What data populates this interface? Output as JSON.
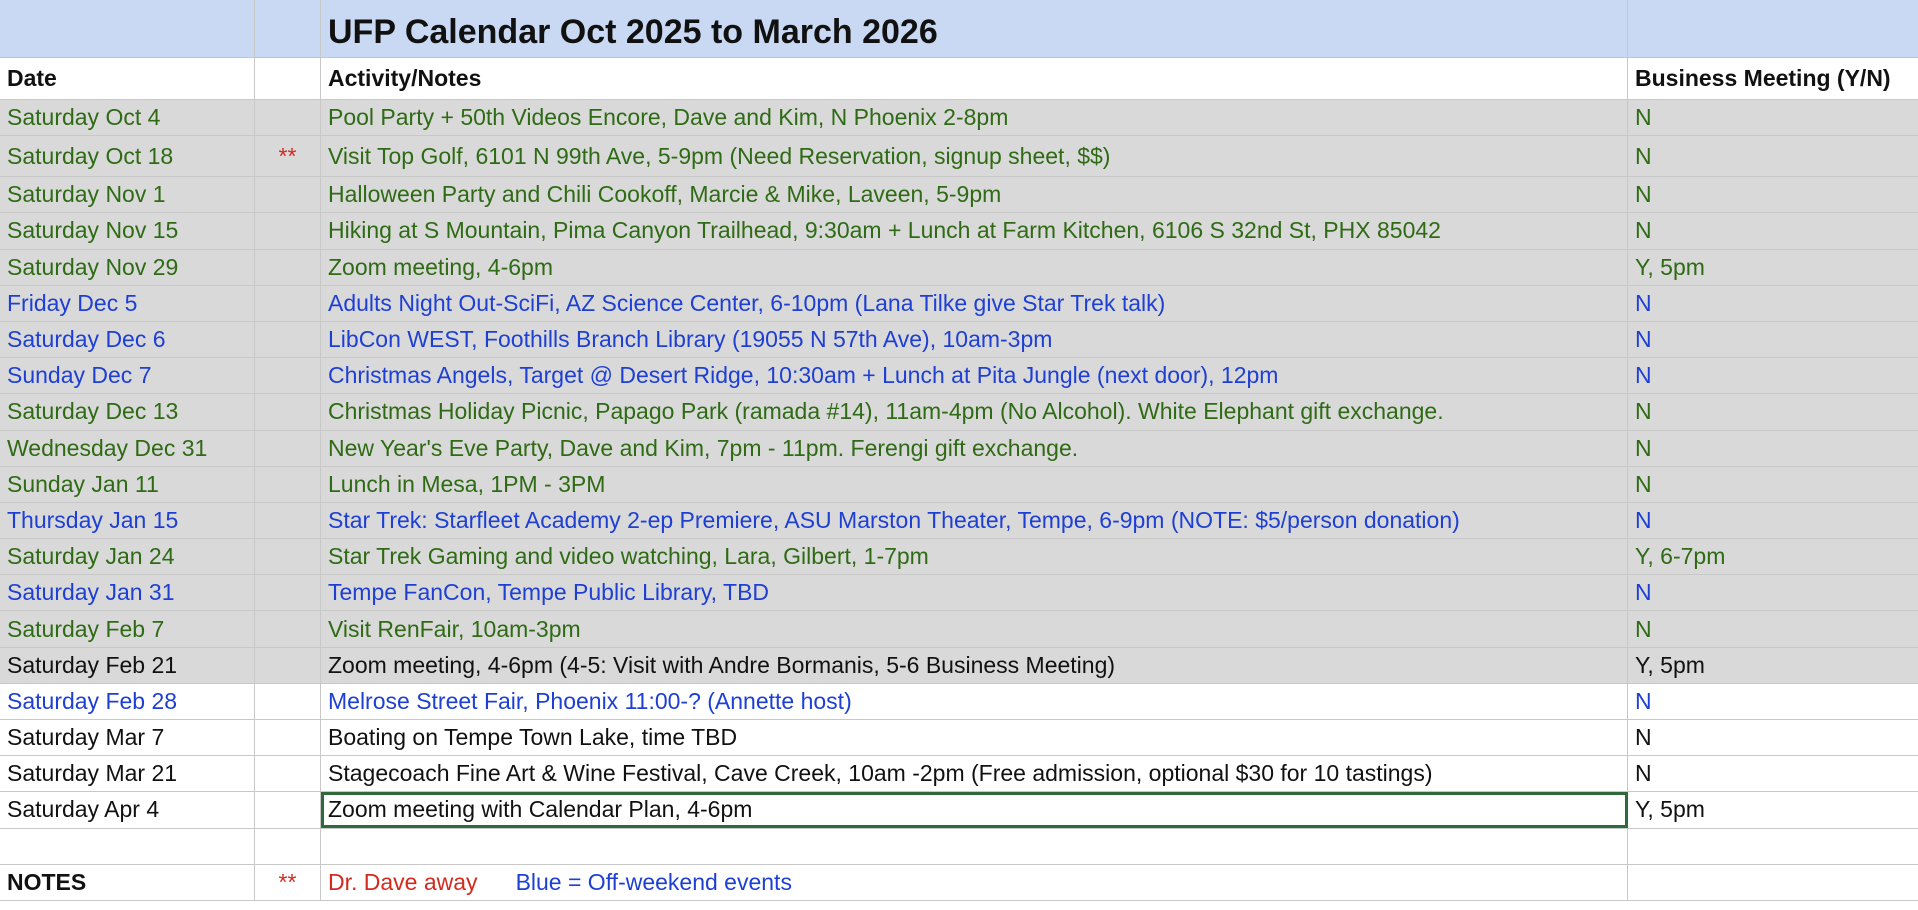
{
  "title": "UFP Calendar Oct 2025 to March 2026",
  "headers": {
    "date": "Date",
    "flag": "",
    "activity": "Activity/Notes",
    "business": "Business Meeting (Y/N)"
  },
  "colors": {
    "green": "#2e6b14",
    "blue": "#1e3fd4",
    "black": "#111111",
    "red": "#d42a1e",
    "title_bg": "#c9d9f3",
    "row_grey": "#d9d9d9"
  },
  "rows": [
    {
      "date": "Saturday Oct 4",
      "flag": "",
      "activity": "Pool Party + 50th Videos Encore, Dave and Kim, N Phoenix 2-8pm",
      "business": "N"
    },
    {
      "date": "Saturday Oct 18",
      "flag": "**",
      "activity": "Visit Top Golf, 6101 N 99th Ave, 5-9pm (Need Reservation, signup sheet, $$)",
      "business": "N"
    },
    {
      "date": "Saturday Nov 1",
      "flag": "",
      "activity": "Halloween Party and Chili Cookoff, Marcie & Mike, Laveen, 5-9pm",
      "business": "N"
    },
    {
      "date": "Saturday Nov 15",
      "flag": "",
      "activity": "Hiking at S Mountain, Pima Canyon Trailhead, 9:30am + Lunch at Farm Kitchen, 6106 S 32nd St, PHX 85042",
      "business": "N"
    },
    {
      "date": "Saturday Nov 29",
      "flag": "",
      "activity": "Zoom meeting, 4-6pm",
      "business": "Y, 5pm"
    },
    {
      "date": "Friday Dec 5",
      "flag": "",
      "activity": "Adults Night Out-SciFi, AZ Science Center, 6-10pm (Lana Tilke give Star Trek talk)",
      "business": "N"
    },
    {
      "date": "Saturday Dec 6",
      "flag": "",
      "activity": "LibCon WEST, Foothills Branch Library (19055 N 57th Ave), 10am-3pm",
      "business": "N"
    },
    {
      "date": "Sunday Dec 7",
      "flag": "",
      "activity": "Christmas Angels, Target @ Desert Ridge, 10:30am + Lunch at Pita Jungle (next door), 12pm",
      "business": "N"
    },
    {
      "date": "Saturday Dec 13",
      "flag": "",
      "activity": "Christmas Holiday Picnic, Papago Park (ramada #14), 11am-4pm (No Alcohol). White Elephant gift exchange.",
      "business": "N"
    },
    {
      "date": "Wednesday Dec 31",
      "flag": "",
      "activity": "New Year's Eve Party, Dave and Kim, 7pm - 11pm.  Ferengi gift exchange.",
      "business": "N"
    },
    {
      "date": "Sunday Jan 11",
      "flag": "",
      "activity": "Lunch in Mesa, 1PM - 3PM",
      "business": "N"
    },
    {
      "date": "Thursday Jan 15",
      "flag": "",
      "activity": "Star Trek: Starfleet Academy 2-ep Premiere, ASU Marston Theater, Tempe, 6-9pm  (NOTE: $5/person donation)",
      "business": "N"
    },
    {
      "date": "Saturday Jan 24",
      "flag": "",
      "activity": "Star Trek Gaming and video watching, Lara, Gilbert, 1-7pm",
      "business": "Y, 6-7pm"
    },
    {
      "date": "Saturday Jan 31",
      "flag": "",
      "activity": "Tempe FanCon, Tempe Public Library, TBD",
      "business": "N"
    },
    {
      "date": "Saturday Feb 7",
      "flag": "",
      "activity": "Visit RenFair, 10am-3pm",
      "business": "N"
    },
    {
      "date": "Saturday Feb 21",
      "flag": "",
      "activity": "Zoom meeting, 4-6pm (4-5: Visit with Andre Bormanis, 5-6 Business Meeting)",
      "business": "Y, 5pm"
    },
    {
      "date": "Saturday Feb 28",
      "flag": "",
      "activity": "Melrose Street Fair, Phoenix 11:00-? (Annette host)",
      "business": "N"
    },
    {
      "date": "Saturday Mar 7",
      "flag": "",
      "activity": "Boating on Tempe Town Lake, time TBD",
      "business": "N"
    },
    {
      "date": "Saturday Mar 21",
      "flag": "",
      "activity": "Stagecoach Fine Art & Wine Festival, Cave Creek, 10am -2pm (Free admission, optional $30 for 10 tastings)",
      "business": "N"
    },
    {
      "date": "Saturday Apr 4",
      "flag": "",
      "activity": "Zoom meeting  with Calendar Plan, 4-6pm",
      "business": "Y, 5pm"
    }
  ],
  "notes": {
    "label": "NOTES",
    "flag": "**",
    "away": "Dr. Dave away",
    "legend": "Blue = Off-weekend events"
  }
}
